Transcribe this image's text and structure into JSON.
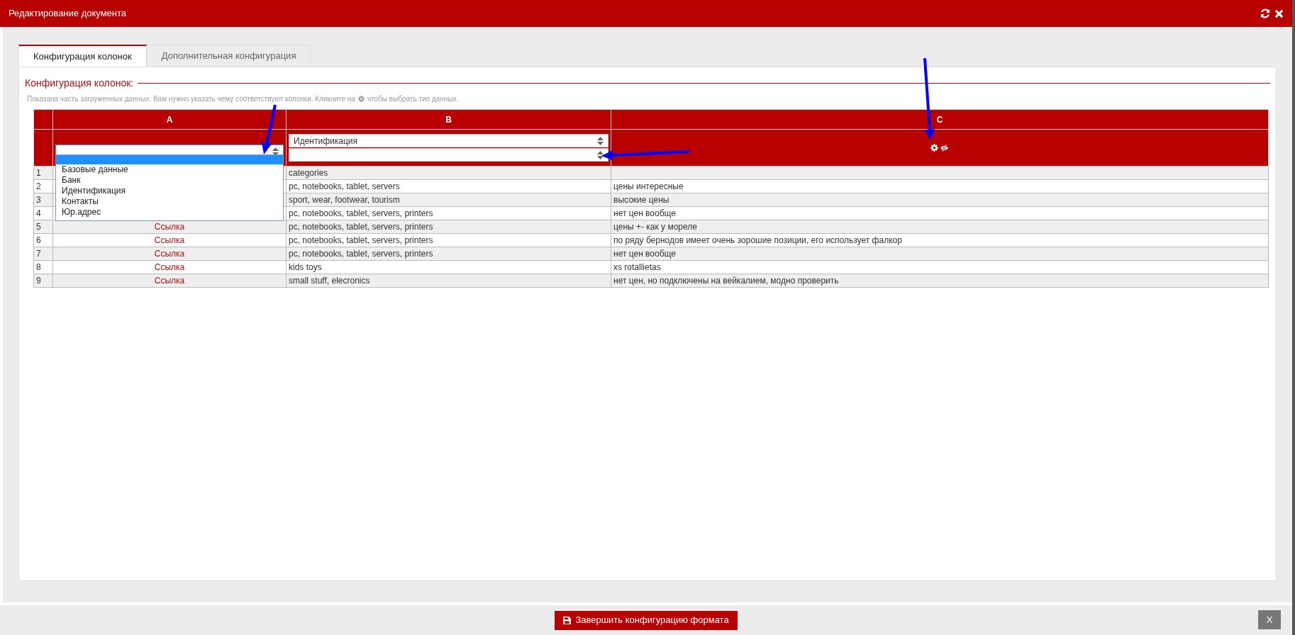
{
  "window": {
    "title": "Редактирование документа"
  },
  "tabs": [
    {
      "label": "Конфигурация колонок",
      "selected": true
    },
    {
      "label": "Дополнительная конфигурация",
      "selected": false
    }
  ],
  "section": {
    "title": "Конфигурация колонок:",
    "hint_before": "Показана часть загруженных данных. Вам нужно указать чему соответствуют колонки. Кликните на",
    "hint_after": "чтобы выбрать тип данных."
  },
  "table": {
    "columns": [
      {
        "letter": "A",
        "kind": "select",
        "fields": [
          {
            "open": true
          }
        ],
        "dropdown": {
          "blank_selected": true,
          "options": [
            "Базовые данные",
            "Банк",
            "Идентификация",
            "Контакты",
            "Юр.адрес"
          ]
        }
      },
      {
        "letter": "B",
        "kind": "select",
        "fields": [
          {
            "value": "Идентификация",
            "open": false
          },
          {
            "open": false
          }
        ]
      },
      {
        "letter": "C",
        "kind": "icons"
      }
    ],
    "rows": [
      {
        "num": "1",
        "b": "categories"
      },
      {
        "num": "2",
        "b": "pc, notebooks, tablet, servers",
        "c": "цены интересные"
      },
      {
        "num": "3",
        "b": "sport, wear, footwear, tourism",
        "c": "высокие цены"
      },
      {
        "num": "4",
        "b": "pc, notebooks, tablet, servers, printers",
        "c": "нет цен вообще"
      },
      {
        "num": "5",
        "a": "Ссылка",
        "b": "pc, notebooks, tablet, servers, printers",
        "c": "цены +- как у мореле"
      },
      {
        "num": "6",
        "a": "Ссылка",
        "b": "pc, notebooks, tablet, servers, printers",
        "c": "по ряду бернодов имеет очень зорошие позиции, его использует фалкор"
      },
      {
        "num": "7",
        "a": "Ссылка",
        "b": "pc, notebooks, tablet, servers, printers",
        "c": "нет цен вообще"
      },
      {
        "num": "8",
        "a": "Ссылка",
        "b": "kids toys",
        "c": "xs rotallietas"
      },
      {
        "num": "9",
        "a": "Ссылка",
        "b": "small stuff, elecronics",
        "c": "нет цен, но подключены на вейкалием, модно проверить"
      }
    ]
  },
  "footer": {
    "primary": "Завершить конфигурацию формата",
    "close": "X"
  }
}
